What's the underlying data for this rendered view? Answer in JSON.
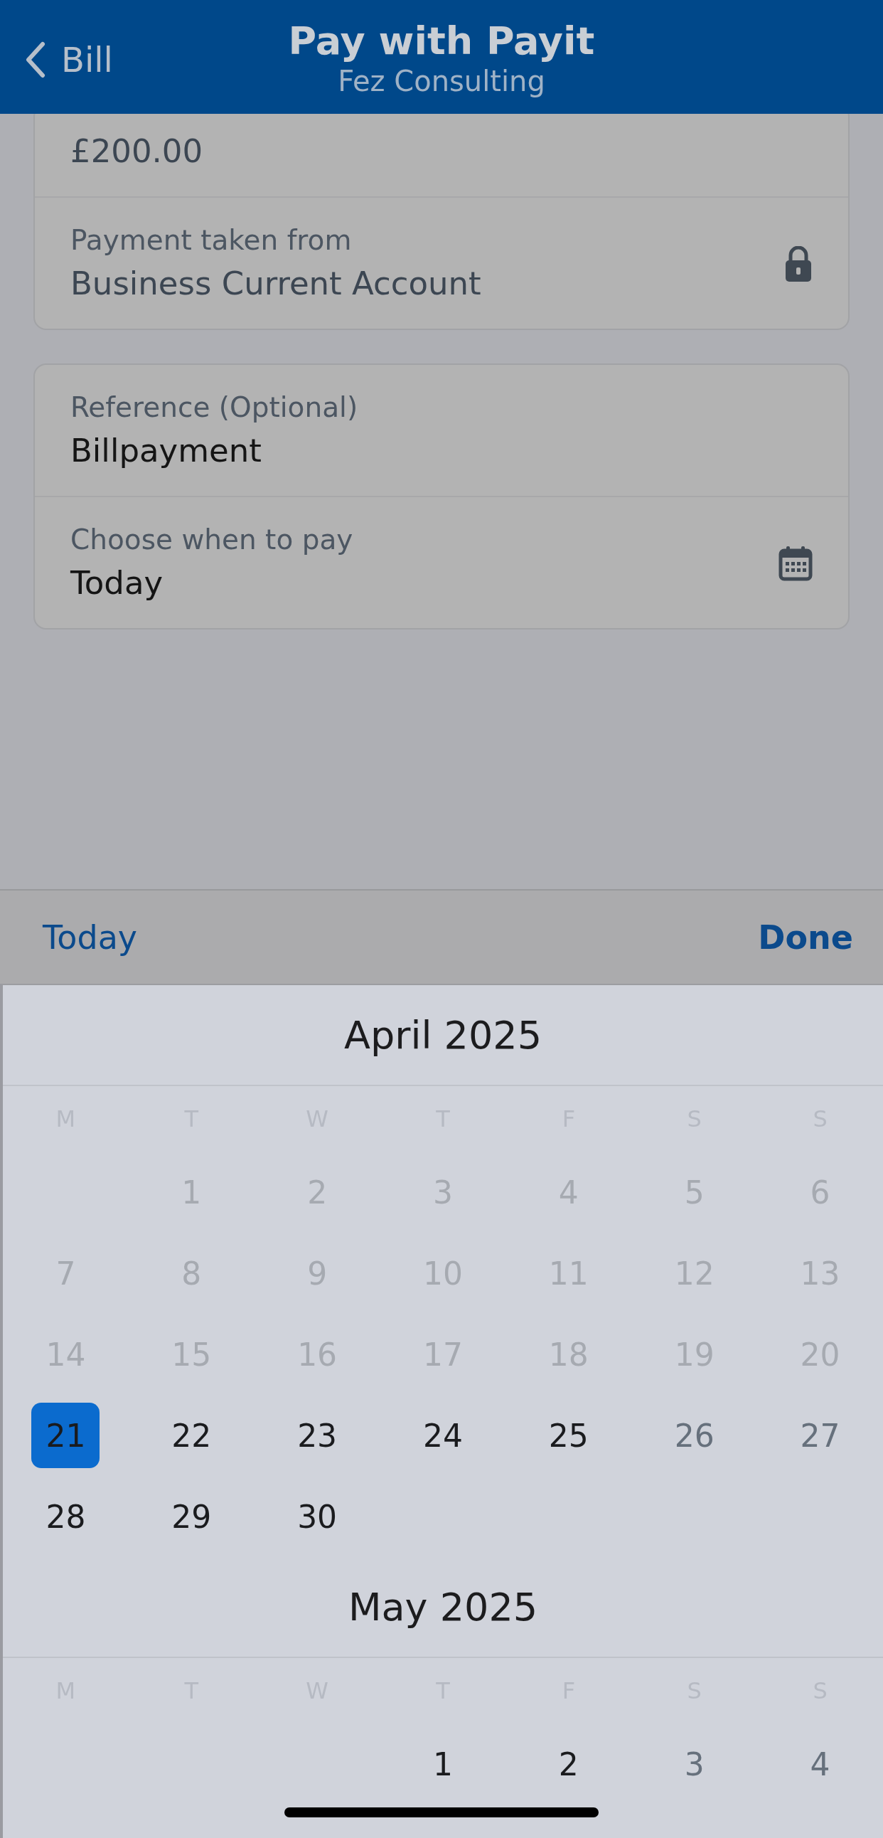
{
  "header": {
    "back_label": "Bill",
    "title": "Pay with Payit",
    "subtitle": "Fez Consulting"
  },
  "cards": [
    {
      "rows": [
        {
          "value": "£200.00",
          "locked": true,
          "kind": "amount"
        },
        {
          "label": "Payment taken from",
          "value": "Business Current Account",
          "locked": true,
          "kind": "account"
        }
      ]
    },
    {
      "rows": [
        {
          "label": "Reference (Optional)",
          "value": "Billpayment",
          "locked": false,
          "kind": "text"
        },
        {
          "label": "Choose when to pay",
          "value": "Today",
          "locked": false,
          "kind": "date"
        }
      ]
    }
  ],
  "picker": {
    "today_button": "Today",
    "done_button": "Done",
    "months": [
      {
        "title": "April 2025",
        "weekdays": [
          "M",
          "T",
          "W",
          "T",
          "F",
          "S",
          "S"
        ],
        "weeks": [
          [
            {
              "kind": "blank"
            },
            {
              "day": "1",
              "kind": "past",
              "selected": false
            },
            {
              "day": "2",
              "kind": "past",
              "selected": false
            },
            {
              "day": "3",
              "kind": "past",
              "selected": false
            },
            {
              "day": "4",
              "kind": "past",
              "selected": false
            },
            {
              "day": "5",
              "kind": "past",
              "selected": false
            },
            {
              "day": "6",
              "kind": "past",
              "selected": false
            }
          ],
          [
            {
              "day": "7",
              "kind": "past",
              "selected": false
            },
            {
              "day": "8",
              "kind": "past",
              "selected": false
            },
            {
              "day": "9",
              "kind": "past",
              "selected": false
            },
            {
              "day": "10",
              "kind": "past",
              "selected": false
            },
            {
              "day": "11",
              "kind": "past",
              "selected": false
            },
            {
              "day": "12",
              "kind": "past",
              "selected": false
            },
            {
              "day": "13",
              "kind": "past",
              "selected": false
            }
          ],
          [
            {
              "day": "14",
              "kind": "past",
              "selected": false
            },
            {
              "day": "15",
              "kind": "past",
              "selected": false
            },
            {
              "day": "16",
              "kind": "past",
              "selected": false
            },
            {
              "day": "17",
              "kind": "past",
              "selected": false
            },
            {
              "day": "18",
              "kind": "past",
              "selected": false
            },
            {
              "day": "19",
              "kind": "past",
              "selected": false
            },
            {
              "day": "20",
              "kind": "past",
              "selected": false
            }
          ],
          [
            {
              "day": "21",
              "kind": "weekday",
              "selected": true
            },
            {
              "day": "22",
              "kind": "weekday",
              "selected": false
            },
            {
              "day": "23",
              "kind": "weekday",
              "selected": false
            },
            {
              "day": "24",
              "kind": "weekday",
              "selected": false
            },
            {
              "day": "25",
              "kind": "weekday",
              "selected": false
            },
            {
              "day": "26",
              "kind": "weekend",
              "selected": false
            },
            {
              "day": "27",
              "kind": "weekend",
              "selected": false
            }
          ],
          [
            {
              "day": "28",
              "kind": "weekday",
              "selected": false
            },
            {
              "day": "29",
              "kind": "weekday",
              "selected": false
            },
            {
              "day": "30",
              "kind": "weekday",
              "selected": false
            }
          ]
        ]
      },
      {
        "title": "May 2025",
        "weekdays": [
          "M",
          "T",
          "W",
          "T",
          "F",
          "S",
          "S"
        ],
        "weeks": [
          [
            {
              "kind": "blank"
            },
            {
              "kind": "blank"
            },
            {
              "kind": "blank"
            },
            {
              "day": "1",
              "kind": "weekday",
              "selected": false
            },
            {
              "day": "2",
              "kind": "weekday",
              "selected": false
            },
            {
              "day": "3",
              "kind": "weekend",
              "selected": false
            },
            {
              "day": "4",
              "kind": "weekend",
              "selected": false
            }
          ]
        ]
      }
    ]
  }
}
